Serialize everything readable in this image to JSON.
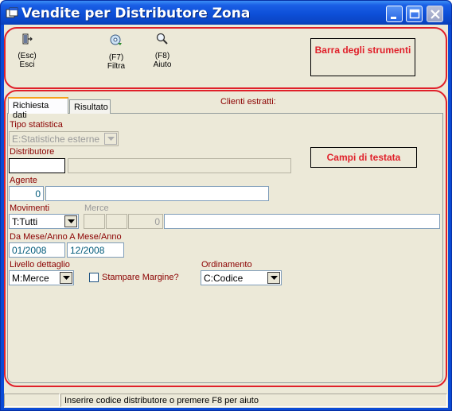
{
  "window": {
    "title": "Vendite per Distributore Zona",
    "title_icon": "app-window-icon",
    "controls": [
      "minimize-icon",
      "maximize-icon",
      "close-icon"
    ]
  },
  "toolbar": {
    "items": [
      {
        "key": "(Esc)",
        "label": "Esci",
        "icon": "exit-door-icon"
      },
      {
        "key": "(F7)",
        "label": "Filtra",
        "icon": "filter-disc-icon"
      },
      {
        "key": "(F8)",
        "label": "Aiuto",
        "icon": "magnifier-help-icon"
      }
    ],
    "callout": "Barra degli strumenti"
  },
  "tabs": [
    {
      "label": "Richiesta dati",
      "active": true
    },
    {
      "label": "Risultato",
      "active": false
    }
  ],
  "clienti_estratti": "Clienti estratti:",
  "header_callout": "Campi di testata",
  "form": {
    "tipo_statistica": {
      "label": "Tipo statistica",
      "value": "E:Statistiche esterne"
    },
    "distributore": {
      "label": "Distributore",
      "code": "",
      "description": ""
    },
    "agente": {
      "label": "Agente",
      "code": "0",
      "description": ""
    },
    "movimenti": {
      "label": "Movimenti",
      "value": "T:Tutti"
    },
    "merce": {
      "label": "Merce",
      "f1": "",
      "f2": "",
      "f3": "0",
      "description": ""
    },
    "periodo": {
      "label": "Da Mese/Anno A Mese/Anno",
      "da": "01/2008",
      "a": "12/2008"
    },
    "livello": {
      "label": "Livello dettaglio",
      "value": "M:Merce"
    },
    "margine": {
      "label": "Stampare Margine?",
      "checked": false
    },
    "ordinamento": {
      "label": "Ordinamento",
      "value": "C:Codice"
    }
  },
  "statusbar": {
    "cell1": "",
    "message": "Inserire codice distributore o premere F8 per aiuto"
  },
  "colors": {
    "titlebar": "#0d4fd8",
    "annotation_red": "#e0202a",
    "label_dark_red": "#8b0000",
    "face": "#ece9d8"
  }
}
